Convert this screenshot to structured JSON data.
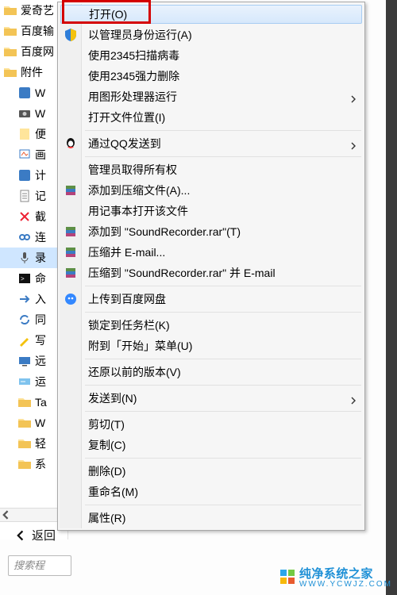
{
  "fileList": {
    "items": [
      {
        "label": "爱奇艺",
        "icon": "folder",
        "indent": false
      },
      {
        "label": "百度输",
        "icon": "folder",
        "indent": false
      },
      {
        "label": "百度网",
        "icon": "folder",
        "indent": false
      },
      {
        "label": "附件",
        "icon": "folder",
        "indent": false
      },
      {
        "label": "W",
        "icon": "app-blue",
        "indent": true
      },
      {
        "label": "W",
        "icon": "camera",
        "indent": true
      },
      {
        "label": "便",
        "icon": "note",
        "indent": true
      },
      {
        "label": "画",
        "icon": "paint",
        "indent": true
      },
      {
        "label": "计",
        "icon": "app-blue",
        "indent": true
      },
      {
        "label": "记",
        "icon": "notepad",
        "indent": true
      },
      {
        "label": "截",
        "icon": "snip",
        "indent": true
      },
      {
        "label": "连",
        "icon": "link",
        "indent": true
      },
      {
        "label": "录",
        "icon": "mic",
        "indent": true,
        "selected": true
      },
      {
        "label": "命",
        "icon": "cmd",
        "indent": true
      },
      {
        "label": "入",
        "icon": "arrow",
        "indent": true
      },
      {
        "label": "同",
        "icon": "sync",
        "indent": true
      },
      {
        "label": "写",
        "icon": "pen",
        "indent": true
      },
      {
        "label": "远",
        "icon": "remote",
        "indent": true
      },
      {
        "label": "运",
        "icon": "run",
        "indent": true
      },
      {
        "label": "Ta",
        "icon": "folder",
        "indent": true
      },
      {
        "label": "W",
        "icon": "folder",
        "indent": true
      },
      {
        "label": "轻",
        "icon": "folder",
        "indent": true
      },
      {
        "label": "系",
        "icon": "folder",
        "indent": true
      }
    ]
  },
  "backLabel": "返回",
  "searchPlaceholder": "搜索程",
  "menu": {
    "items": [
      {
        "label": "打开(O)",
        "highlighted": true,
        "selected": true
      },
      {
        "label": "以管理员身份运行(A)",
        "icon": "shield"
      },
      {
        "label": "使用2345扫描病毒"
      },
      {
        "label": "使用2345强力删除"
      },
      {
        "label": "用图形处理器运行",
        "submenu": true
      },
      {
        "label": "打开文件位置(I)"
      },
      {
        "sep": true
      },
      {
        "label": "通过QQ发送到",
        "icon": "qq",
        "submenu": true
      },
      {
        "sep": true
      },
      {
        "label": "管理员取得所有权"
      },
      {
        "label": "添加到压缩文件(A)...",
        "icon": "rar"
      },
      {
        "label": "用记事本打开该文件"
      },
      {
        "label": "添加到 \"SoundRecorder.rar\"(T)",
        "icon": "rar"
      },
      {
        "label": "压缩并 E-mail...",
        "icon": "rar"
      },
      {
        "label": "压缩到 \"SoundRecorder.rar\" 并 E-mail",
        "icon": "rar"
      },
      {
        "sep": true
      },
      {
        "label": "上传到百度网盘",
        "icon": "baidu"
      },
      {
        "sep": true
      },
      {
        "label": "锁定到任务栏(K)"
      },
      {
        "label": "附到「开始」菜单(U)"
      },
      {
        "sep": true
      },
      {
        "label": "还原以前的版本(V)"
      },
      {
        "sep": true
      },
      {
        "label": "发送到(N)",
        "submenu": true
      },
      {
        "sep": true
      },
      {
        "label": "剪切(T)"
      },
      {
        "label": "复制(C)"
      },
      {
        "sep": true
      },
      {
        "label": "删除(D)"
      },
      {
        "label": "重命名(M)"
      },
      {
        "sep": true
      },
      {
        "label": "属性(R)"
      }
    ]
  },
  "watermark": {
    "main": "纯净系统之家",
    "sub": "WWW.YCWJZ.COM"
  },
  "colors": {
    "accent": "#1e90d6",
    "hlRed": "#d40000"
  }
}
